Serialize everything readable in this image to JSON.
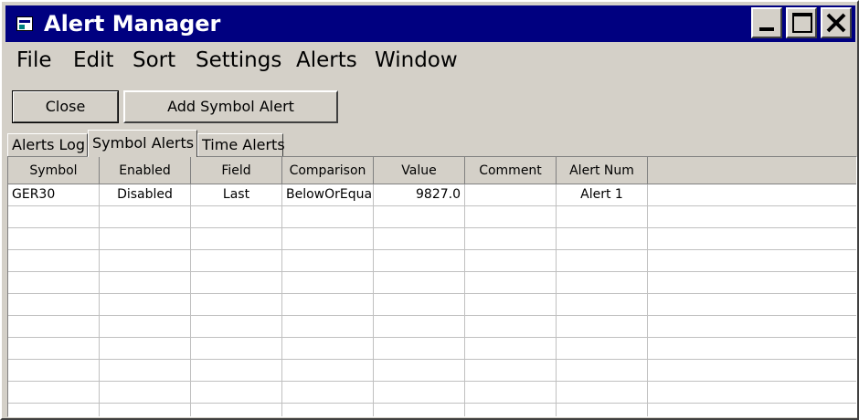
{
  "window": {
    "title": "Alert Manager"
  },
  "menu": [
    "File",
    "Edit",
    "Sort",
    "Settings",
    "Alerts",
    "Window"
  ],
  "toolbar": {
    "close_label": "Close",
    "add_label": "Add Symbol Alert"
  },
  "tabs": [
    {
      "label": "Alerts Log",
      "active": false
    },
    {
      "label": "Symbol Alerts",
      "active": true
    },
    {
      "label": "Time Alerts",
      "active": false
    }
  ],
  "table": {
    "columns": [
      "Symbol",
      "Enabled",
      "Field",
      "Comparison",
      "Value",
      "Comment",
      "Alert Num"
    ],
    "rows": [
      [
        "GER30",
        "Disabled",
        "Last",
        "BelowOrEqual",
        "9827.0",
        "",
        "Alert 1"
      ]
    ]
  },
  "colors": {
    "titlebar": "#000080",
    "face": "#d4d0c8"
  }
}
